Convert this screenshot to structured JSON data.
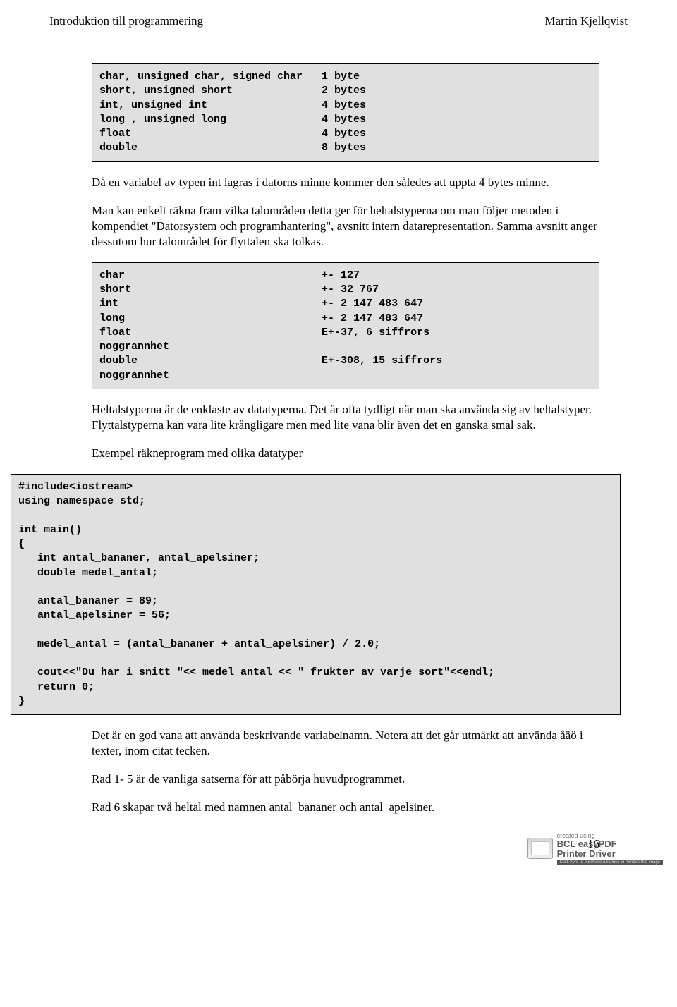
{
  "header": {
    "left": "Introduktion till programmering",
    "right": "Martin Kjellqvist"
  },
  "codebox1": "char, unsigned char, signed char   1 byte\nshort, unsigned short              2 bytes\nint, unsigned int                  4 bytes\nlong , unsigned long               4 bytes\nfloat                              4 bytes\ndouble                             8 bytes",
  "para1": "Då en variabel av typen int lagras i datorns minne kommer den således att uppta 4 bytes minne.",
  "para2": "Man kan enkelt räkna fram vilka talområden detta ger för heltalstyperna om man följer metoden i kompendiet \"Datorsystem och programhantering\", avsnitt intern datarepresentation. Samma avsnitt anger dessutom hur talområdet för flyttalen ska tolkas.",
  "codebox2": "char                               +- 127\nshort                              +- 32 767\nint                                +- 2 147 483 647\nlong                               +- 2 147 483 647\nfloat                              E+-37, 6 siffrors\nnoggrannhet\ndouble                             E+-308, 15 siffrors\nnoggrannhet",
  "para3": "Heltalstyperna är de enklaste av datatyperna. Det är ofta tydligt när man ska använda sig av heltalstyper. Flyttalstyperna kan vara lite krångligare men med lite vana blir även det en ganska smal sak.",
  "para4": "Exempel räkneprogram med olika datatyper",
  "codebox3": "#include<iostream>\nusing namespace std;\n\nint main()\n{\n   int antal_bananer, antal_apelsiner;\n   double medel_antal;\n\n   antal_bananer = 89;\n   antal_apelsiner = 56;\n\n   medel_antal = (antal_bananer + antal_apelsiner) / 2.0;\n\n   cout<<\"Du har i snitt \"<< medel_antal << \" frukter av varje sort\"<<endl;\n   return 0;\n}",
  "para5": "Det är en god vana att använda beskrivande variabelnamn. Notera att det går utmärkt att använda åäö i texter, inom citat tecken.",
  "para6": "Rad 1- 5 är de vanliga satserna för att påbörja huvudprogrammet.",
  "para7": "Rad 6 skapar två heltal med namnen antal_bananer och antal_apelsiner.",
  "page_number": "16",
  "watermark": {
    "created": "created using",
    "line1": "BCL easyPDF",
    "line2": "Printer Driver",
    "click": "Click here to purchase a license to remove this image"
  }
}
